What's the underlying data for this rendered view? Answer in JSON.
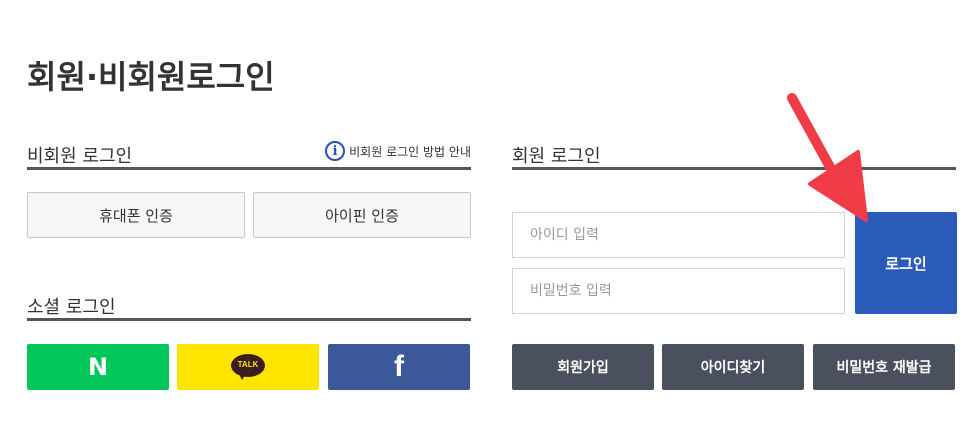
{
  "page": {
    "title": "회원·비회원로그인"
  },
  "guest": {
    "heading": "비회원 로그인",
    "help_link": "비회원 로그인 방법 안내",
    "phone_auth_label": "휴대폰 인증",
    "ipin_auth_label": "아이핀 인증"
  },
  "social": {
    "heading": "소셜 로그인",
    "naver_icon": "N",
    "kakao_icon": "TALK",
    "facebook_icon": "f"
  },
  "member": {
    "heading": "회원 로그인",
    "id_placeholder": "아이디 입력",
    "pw_placeholder": "비밀번호 입력",
    "login_label": "로그인",
    "join_label": "회원가입",
    "find_id_label": "아이디찾기",
    "reset_pw_label": "비밀번호 재발급"
  },
  "colors": {
    "login_blue": "#2a5bb8",
    "dark_button": "#4a505e",
    "naver_green": "#03c75a",
    "kakao_yellow": "#fee500",
    "facebook_blue": "#3b5998",
    "annotation_arrow": "#f03c46"
  }
}
